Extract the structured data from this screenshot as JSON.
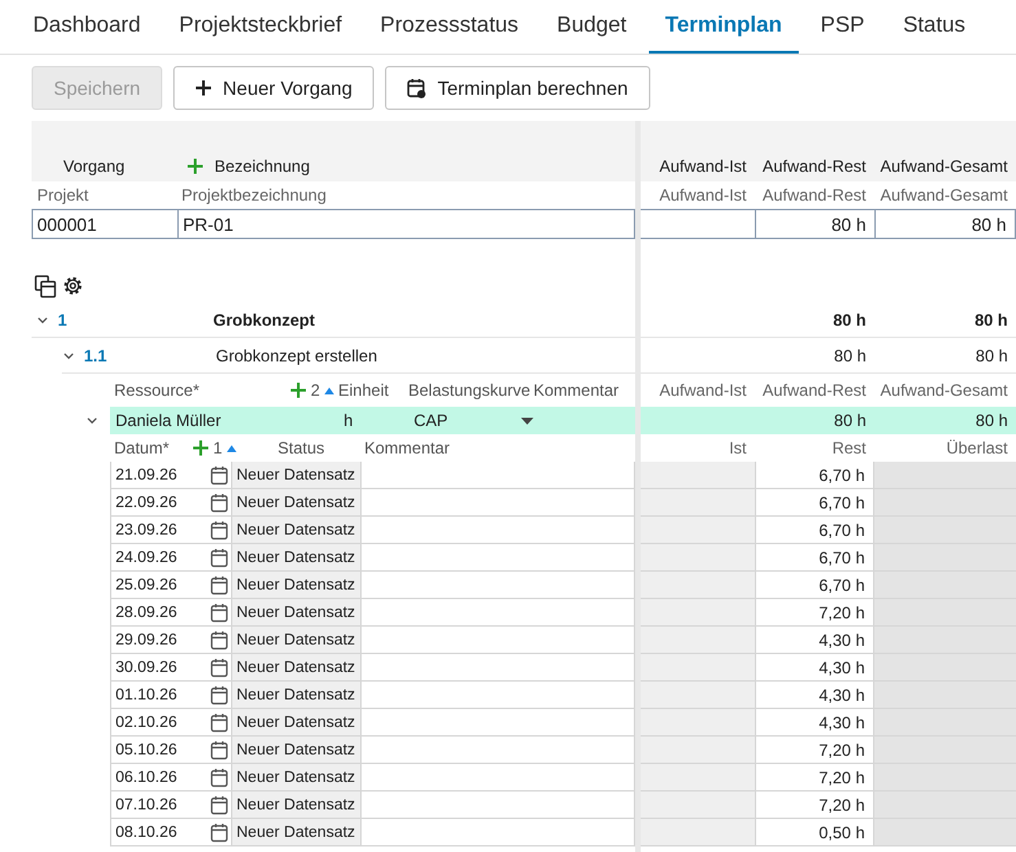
{
  "tabs": [
    {
      "label": "Dashboard",
      "selected": false
    },
    {
      "label": "Projektsteckbrief",
      "selected": false
    },
    {
      "label": "Prozessstatus",
      "selected": false
    },
    {
      "label": "Budget",
      "selected": false
    },
    {
      "label": "Terminplan",
      "selected": true
    },
    {
      "label": "PSP",
      "selected": false
    },
    {
      "label": "Status",
      "selected": false
    }
  ],
  "toolbar": [
    {
      "label": "Speichern",
      "kind": "plain",
      "disabled": true
    },
    {
      "label": "Neuer Vorgang",
      "kind": "add",
      "disabled": false
    },
    {
      "label": "Terminplan berechnen",
      "kind": "calendar",
      "disabled": false
    }
  ],
  "grid_header": {
    "columns": [
      "Vorgang",
      "Bezeichnung"
    ],
    "effort_columns": [
      "Aufwand-Ist",
      "Aufwand-Rest",
      "Aufwand-Gesamt"
    ]
  },
  "project": {
    "columns": [
      "Projekt",
      "Projektbezeichnung"
    ],
    "effort_columns": [
      "Aufwand-Ist",
      "Aufwand-Rest",
      "Aufwand-Gesamt"
    ],
    "number": "000001",
    "name": "PR-01",
    "effort_rest": "80 h",
    "effort_total": "80 h"
  },
  "tasks": [
    {
      "number": "1",
      "title": "Grobkonzept",
      "expanded": true,
      "effort_rest": "80 h",
      "effort_total": "80 h",
      "children": [
        {
          "number": "1.1",
          "title": "Grobkonzept erstellen",
          "expanded": true,
          "effort_rest": "80 h",
          "effort_total": "80 h",
          "resources": {
            "columns": [
              "Ressource*",
              "Einheit",
              "Belastungskurve",
              "Kommentar"
            ],
            "count": "2",
            "effort_columns": [
              "Aufwand-Ist",
              "Aufwand-Rest",
              "Aufwand-Gesamt"
            ],
            "rows": [
              {
                "name": "Daniela Müller",
                "unit": "h",
                "curve": "CAP",
                "expanded": true,
                "selected": true,
                "effort_rest": "80 h",
                "effort_total": "80 h",
                "schedule": {
                  "columns": [
                    "Datum*",
                    "Status",
                    "Kommentar"
                  ],
                  "count": "1",
                  "value_columns": [
                    "Ist",
                    "Rest",
                    "Überlast"
                  ],
                  "rows": [
                    {
                      "date": "21.09.26",
                      "status": "Neuer Datensatz",
                      "rest": "6,70 h"
                    },
                    {
                      "date": "22.09.26",
                      "status": "Neuer Datensatz",
                      "rest": "6,70 h"
                    },
                    {
                      "date": "23.09.26",
                      "status": "Neuer Datensatz",
                      "rest": "6,70 h"
                    },
                    {
                      "date": "24.09.26",
                      "status": "Neuer Datensatz",
                      "rest": "6,70 h"
                    },
                    {
                      "date": "25.09.26",
                      "status": "Neuer Datensatz",
                      "rest": "6,70 h"
                    },
                    {
                      "date": "28.09.26",
                      "status": "Neuer Datensatz",
                      "rest": "7,20 h"
                    },
                    {
                      "date": "29.09.26",
                      "status": "Neuer Datensatz",
                      "rest": "4,30 h"
                    },
                    {
                      "date": "30.09.26",
                      "status": "Neuer Datensatz",
                      "rest": "4,30 h"
                    },
                    {
                      "date": "01.10.26",
                      "status": "Neuer Datensatz",
                      "rest": "4,30 h"
                    },
                    {
                      "date": "02.10.26",
                      "status": "Neuer Datensatz",
                      "rest": "4,30 h"
                    },
                    {
                      "date": "05.10.26",
                      "status": "Neuer Datensatz",
                      "rest": "7,20 h"
                    },
                    {
                      "date": "06.10.26",
                      "status": "Neuer Datensatz",
                      "rest": "7,20 h"
                    },
                    {
                      "date": "07.10.26",
                      "status": "Neuer Datensatz",
                      "rest": "7,20 h"
                    },
                    {
                      "date": "08.10.26",
                      "status": "Neuer Datensatz",
                      "rest": "0,50 h"
                    }
                  ]
                }
              }
            ]
          }
        }
      ]
    }
  ]
}
